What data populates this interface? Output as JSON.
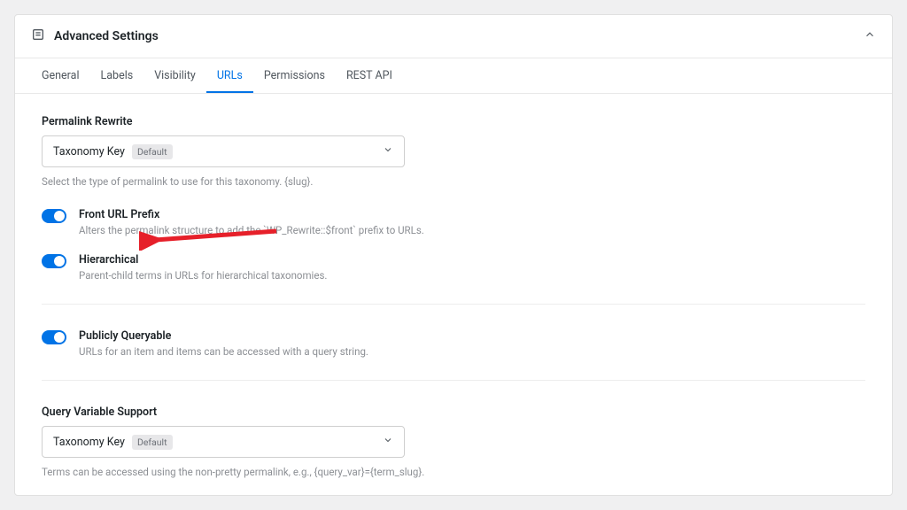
{
  "header": {
    "title": "Advanced Settings"
  },
  "tabs": [
    {
      "label": "General",
      "active": false
    },
    {
      "label": "Labels",
      "active": false
    },
    {
      "label": "Visibility",
      "active": false
    },
    {
      "label": "URLs",
      "active": true
    },
    {
      "label": "Permissions",
      "active": false
    },
    {
      "label": "REST API",
      "active": false
    }
  ],
  "permalink": {
    "label": "Permalink Rewrite",
    "value": "Taxonomy Key",
    "badge": "Default",
    "help": "Select the type of permalink to use for this taxonomy. {slug}."
  },
  "toggles": {
    "front_url": {
      "label": "Front URL Prefix",
      "desc": "Alters the permalink structure to add the `WP_Rewrite::$front` prefix to URLs."
    },
    "hierarchical": {
      "label": "Hierarchical",
      "desc": "Parent-child terms in URLs for hierarchical taxonomies."
    },
    "publicly_queryable": {
      "label": "Publicly Queryable",
      "desc": "URLs for an item and items can be accessed with a query string."
    }
  },
  "query_var": {
    "label": "Query Variable Support",
    "value": "Taxonomy Key",
    "badge": "Default",
    "help": "Terms can be accessed using the non-pretty permalink, e.g., {query_var}={term_slug}."
  }
}
